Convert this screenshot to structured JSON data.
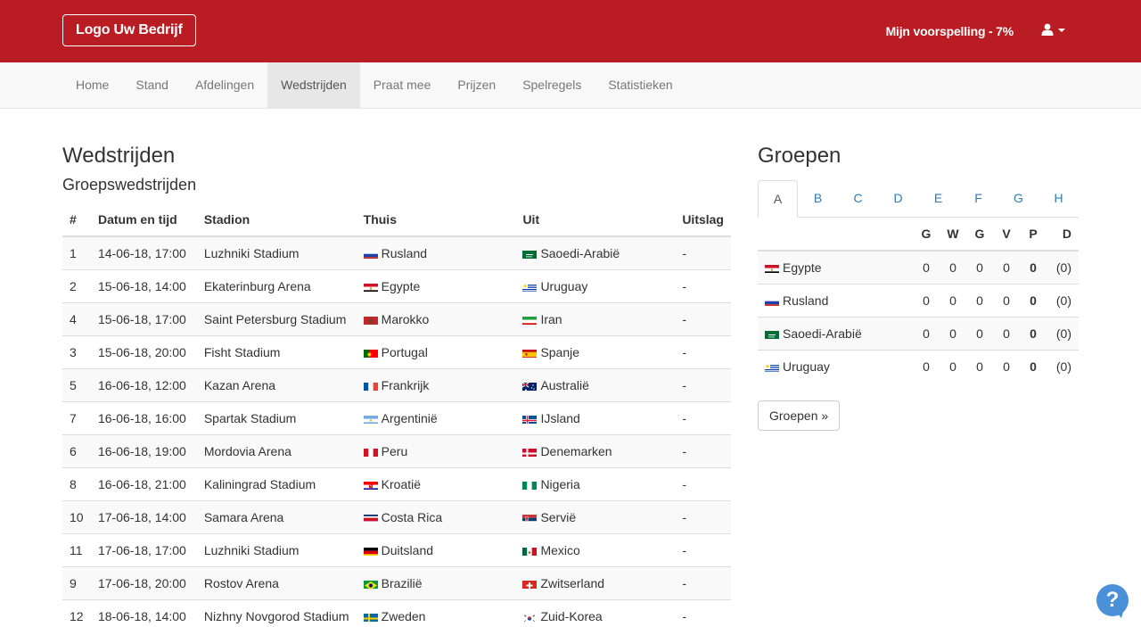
{
  "header": {
    "logo_label": "Logo Uw Bedrijf",
    "prediction_label": "Mijn voorspelling - 7%",
    "user_icon": "user-icon",
    "brand_color": "#b91c22"
  },
  "nav": {
    "items": [
      {
        "label": "Home"
      },
      {
        "label": "Stand"
      },
      {
        "label": "Afdelingen"
      },
      {
        "label": "Wedstrijden",
        "active": true
      },
      {
        "label": "Praat mee"
      },
      {
        "label": "Prijzen"
      },
      {
        "label": "Spelregels"
      },
      {
        "label": "Statistieken"
      }
    ]
  },
  "main": {
    "title": "Wedstrijden",
    "subtitle": "Groepswedstrijden",
    "columns": [
      "#",
      "Datum en tijd",
      "Stadion",
      "Thuis",
      "Uit",
      "Uitslag"
    ],
    "rows": [
      {
        "nr": "1",
        "date": "14-06-18, 17:00",
        "stadium": "Luzhniki Stadium",
        "home": "Rusland",
        "home_flag": "ru",
        "away": "Saoedi-Arabië",
        "away_flag": "sa",
        "result": "-"
      },
      {
        "nr": "2",
        "date": "15-06-18, 14:00",
        "stadium": "Ekaterinburg Arena",
        "home": "Egypte",
        "home_flag": "eg",
        "away": "Uruguay",
        "away_flag": "uy",
        "result": "-"
      },
      {
        "nr": "4",
        "date": "15-06-18, 17:00",
        "stadium": "Saint Petersburg Stadium",
        "home": "Marokko",
        "home_flag": "ma",
        "away": "Iran",
        "away_flag": "ir",
        "result": "-"
      },
      {
        "nr": "3",
        "date": "15-06-18, 20:00",
        "stadium": "Fisht Stadium",
        "home": "Portugal",
        "home_flag": "pt",
        "away": "Spanje",
        "away_flag": "es",
        "result": "-"
      },
      {
        "nr": "5",
        "date": "16-06-18, 12:00",
        "stadium": "Kazan Arena",
        "home": "Frankrijk",
        "home_flag": "fr",
        "away": "Australië",
        "away_flag": "au",
        "result": "-"
      },
      {
        "nr": "7",
        "date": "16-06-18, 16:00",
        "stadium": "Spartak Stadium",
        "home": "Argentinië",
        "home_flag": "ar",
        "away": "IJsland",
        "away_flag": "is",
        "result": "-"
      },
      {
        "nr": "6",
        "date": "16-06-18, 19:00",
        "stadium": "Mordovia Arena",
        "home": "Peru",
        "home_flag": "pe",
        "away": "Denemarken",
        "away_flag": "dk",
        "result": "-"
      },
      {
        "nr": "8",
        "date": "16-06-18, 21:00",
        "stadium": "Kaliningrad Stadium",
        "home": "Kroatië",
        "home_flag": "hr",
        "away": "Nigeria",
        "away_flag": "ng",
        "result": "-"
      },
      {
        "nr": "10",
        "date": "17-06-18, 14:00",
        "stadium": "Samara Arena",
        "home": "Costa Rica",
        "home_flag": "cr",
        "away": "Servië",
        "away_flag": "rs",
        "result": "-"
      },
      {
        "nr": "11",
        "date": "17-06-18, 17:00",
        "stadium": "Luzhniki Stadium",
        "home": "Duitsland",
        "home_flag": "de",
        "away": "Mexico",
        "away_flag": "mx",
        "result": "-"
      },
      {
        "nr": "9",
        "date": "17-06-18, 20:00",
        "stadium": "Rostov Arena",
        "home": "Brazilië",
        "home_flag": "br",
        "away": "Zwitserland",
        "away_flag": "ch",
        "result": "-"
      },
      {
        "nr": "12",
        "date": "18-06-18, 14:00",
        "stadium": "Nizhny Novgorod Stadium",
        "home": "Zweden",
        "home_flag": "se",
        "away": "Zuid-Korea",
        "away_flag": "kr",
        "result": "-"
      }
    ]
  },
  "groups": {
    "title": "Groepen",
    "tabs": [
      "A",
      "B",
      "C",
      "D",
      "E",
      "F",
      "G",
      "H"
    ],
    "active_tab": "A",
    "columns": [
      "G",
      "W",
      "G",
      "V",
      "P",
      "D"
    ],
    "rows": [
      {
        "team": "Egypte",
        "flag": "eg",
        "g": "0",
        "w": "0",
        "g2": "0",
        "v": "0",
        "p": "0",
        "d": "(0)"
      },
      {
        "team": "Rusland",
        "flag": "ru",
        "g": "0",
        "w": "0",
        "g2": "0",
        "v": "0",
        "p": "0",
        "d": "(0)"
      },
      {
        "team": "Saoedi-Arabië",
        "flag": "sa",
        "g": "0",
        "w": "0",
        "g2": "0",
        "v": "0",
        "p": "0",
        "d": "(0)"
      },
      {
        "team": "Uruguay",
        "flag": "uy",
        "g": "0",
        "w": "0",
        "g2": "0",
        "v": "0",
        "p": "0",
        "d": "(0)"
      }
    ],
    "button_label": "Groepen »"
  },
  "help": {
    "label": "?",
    "icon": "help-icon",
    "color": "#4a90d9"
  }
}
